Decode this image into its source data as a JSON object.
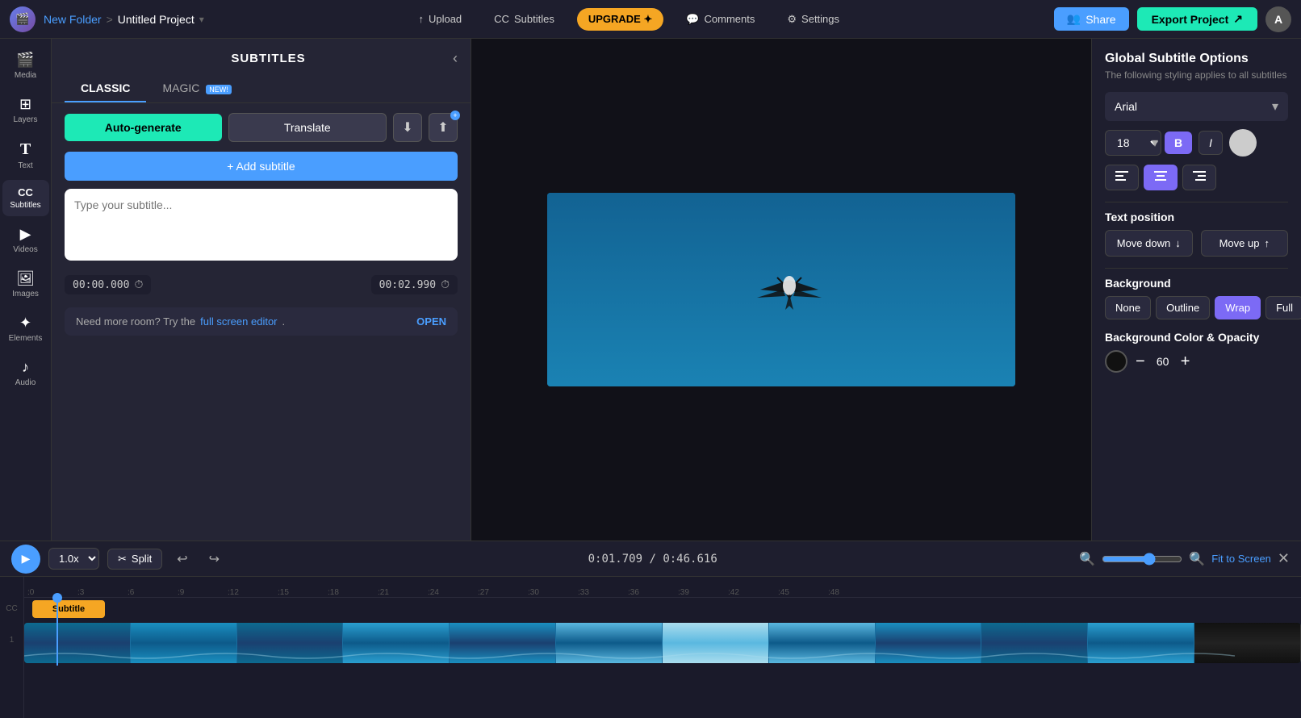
{
  "topbar": {
    "folder": "New Folder",
    "separator": ">",
    "project": "Untitled Project",
    "upload_label": "Upload",
    "subtitles_label": "Subtitles",
    "upgrade_label": "UPGRADE ✦",
    "comments_label": "Comments",
    "settings_label": "Settings",
    "share_label": "Share",
    "export_label": "Export Project",
    "avatar_initial": "A"
  },
  "sidebar": {
    "items": [
      {
        "id": "media",
        "label": "Media",
        "icon": "🎬"
      },
      {
        "id": "layers",
        "label": "Layers",
        "icon": "⊞"
      },
      {
        "id": "text",
        "label": "Text",
        "icon": "T"
      },
      {
        "id": "subtitles",
        "label": "Subtitles",
        "icon": "CC"
      },
      {
        "id": "videos",
        "label": "Videos",
        "icon": "▶"
      },
      {
        "id": "images",
        "label": "Images",
        "icon": "🖼"
      },
      {
        "id": "elements",
        "label": "Elements",
        "icon": "✦"
      },
      {
        "id": "audio",
        "label": "Audio",
        "icon": "♪"
      }
    ]
  },
  "subtitles_panel": {
    "title": "SUBTITLES",
    "tab_classic": "CLASSIC",
    "tab_magic": "MAGIC",
    "magic_badge": "NEW!",
    "auto_generate": "Auto-generate",
    "translate": "Translate",
    "add_subtitle": "+ Add subtitle",
    "subtitle_placeholder": "Type your subtitle...",
    "time_start": "00:00.000",
    "time_end": "00:02.990",
    "more_room_text": "Need more room? Try the ",
    "full_screen_link": "full screen editor",
    "more_room_suffix": ".",
    "open_label": "OPEN"
  },
  "right_panel": {
    "title": "Global Subtitle Options",
    "subtitle": "The following styling applies to all subtitles",
    "font_name": "Arial",
    "font_size": "18",
    "bold_label": "B",
    "italic_label": "I",
    "align_left": "≡",
    "align_center": "≡",
    "align_right": "≡",
    "text_position_label": "Text position",
    "move_down_label": "Move down",
    "move_up_label": "Move up",
    "background_label": "Background",
    "bg_none": "None",
    "bg_outline": "Outline",
    "bg_wrap": "Wrap",
    "bg_full": "Full",
    "bg_color_label": "Background Color & Opacity",
    "opacity_value": "60",
    "minus_label": "−",
    "plus_label": "+"
  },
  "timeline": {
    "speed": "1.0x",
    "split_label": "Split",
    "time_current": "0:01.709",
    "time_total": "0:46.616",
    "fit_screen": "Fit to Screen",
    "ruler_ticks": [
      ":0",
      ":3",
      ":6",
      ":9",
      ":12",
      ":15",
      ":18",
      ":21",
      ":24",
      ":27",
      ":30",
      ":33",
      ":36",
      ":39",
      ":42",
      ":45",
      ":48"
    ],
    "subtitle_clip_label": "Subtitle",
    "track_num": "1"
  }
}
